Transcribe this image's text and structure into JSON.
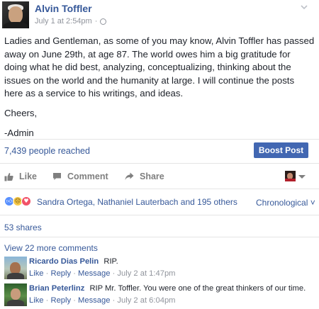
{
  "post": {
    "author": "Alvin Toffler",
    "date": "July 1 at 2:54pm",
    "separator": "·",
    "body": [
      "Ladies and Gentleman, as some of you may know, Alvin Toffler has passed away on June 29th, at age 87. The world owes him a big gratitude for doing what he did best, analyzing, conceptualizing, thinking about the issues on the world and the humanity at large. I will continue the posts here as a service to his writings, and ideas.",
      "Cheers,",
      "-Admin"
    ],
    "icons": {
      "audience": "globe-icon",
      "menu": "chevron-down-icon"
    }
  },
  "insights": {
    "reach_text": "7,439 people reached",
    "boost_label": "Boost Post",
    "boost_color": "#4267b2"
  },
  "actions": {
    "like": "Like",
    "comment": "Comment",
    "share": "Share"
  },
  "reactions": {
    "icons": [
      "like-reaction-icon",
      "sad-reaction-icon",
      "love-reaction-icon"
    ],
    "summary": "Sandra Ortega, Nathaniel Lauterbach and 195 others",
    "sort_label": "Chronological",
    "sort_caret": "˅"
  },
  "shares_text": "53 shares",
  "view_more": "View 22 more comments",
  "comments": [
    {
      "name": "Ricardo Dias Pelin",
      "text": "RIP.",
      "like": "Like",
      "reply": "Reply",
      "message": "Message",
      "sep": "·",
      "time": "July 2 at 1:47pm"
    },
    {
      "name": "Brian Peterlinz",
      "text": "RIP Mr. Toffler. You were one of the great thinkers of our time.",
      "like": "Like",
      "reply": "Reply",
      "message": "Message",
      "sep": "·",
      "time": "July 2 at 6:04pm"
    }
  ],
  "colors": {
    "link": "#365899",
    "text": "#1d2129",
    "muted": "#90949c",
    "action_grey": "#7f7f7f"
  }
}
